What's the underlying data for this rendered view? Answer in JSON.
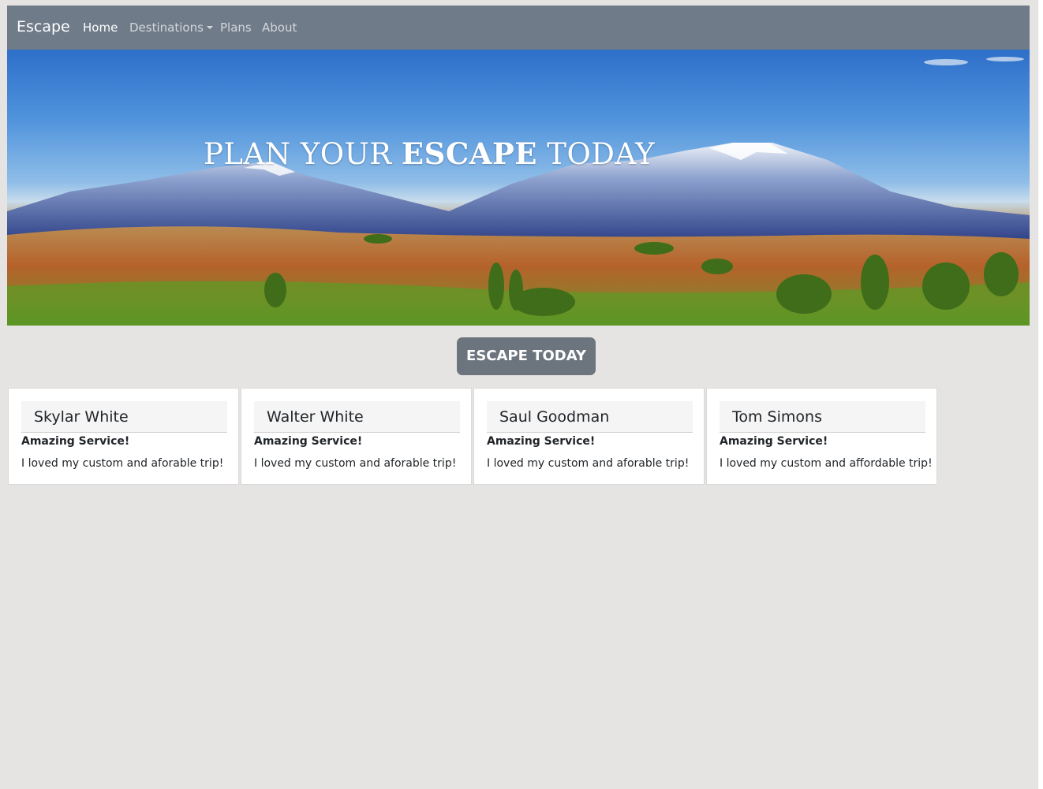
{
  "navbar": {
    "brand": "Escape",
    "links": {
      "home": "Home",
      "destinations": "Destinations",
      "plans": "Plans",
      "about": "About"
    }
  },
  "hero": {
    "title_part1": "PLAN YOUR ",
    "title_bold": "ESCAPE",
    "title_part2": " TODAY"
  },
  "cta": {
    "label": "ESCAPE TODAY"
  },
  "testimonials": [
    {
      "name": "Skylar White",
      "title": "Amazing Service!",
      "text": "I loved my custom and aforable trip!"
    },
    {
      "name": "Walter White",
      "title": "Amazing Service!",
      "text": "I loved my custom and aforable trip!"
    },
    {
      "name": "Saul Goodman",
      "title": "Amazing Service!",
      "text": "I loved my custom and aforable trip!"
    },
    {
      "name": "Tom Simons",
      "title": "Amazing Service!",
      "text": "I loved my custom and affordable trip!"
    }
  ],
  "colors": {
    "navbar_bg": "#6f7b89",
    "button_bg": "#6c757d",
    "page_bg": "#e5e4e2"
  }
}
